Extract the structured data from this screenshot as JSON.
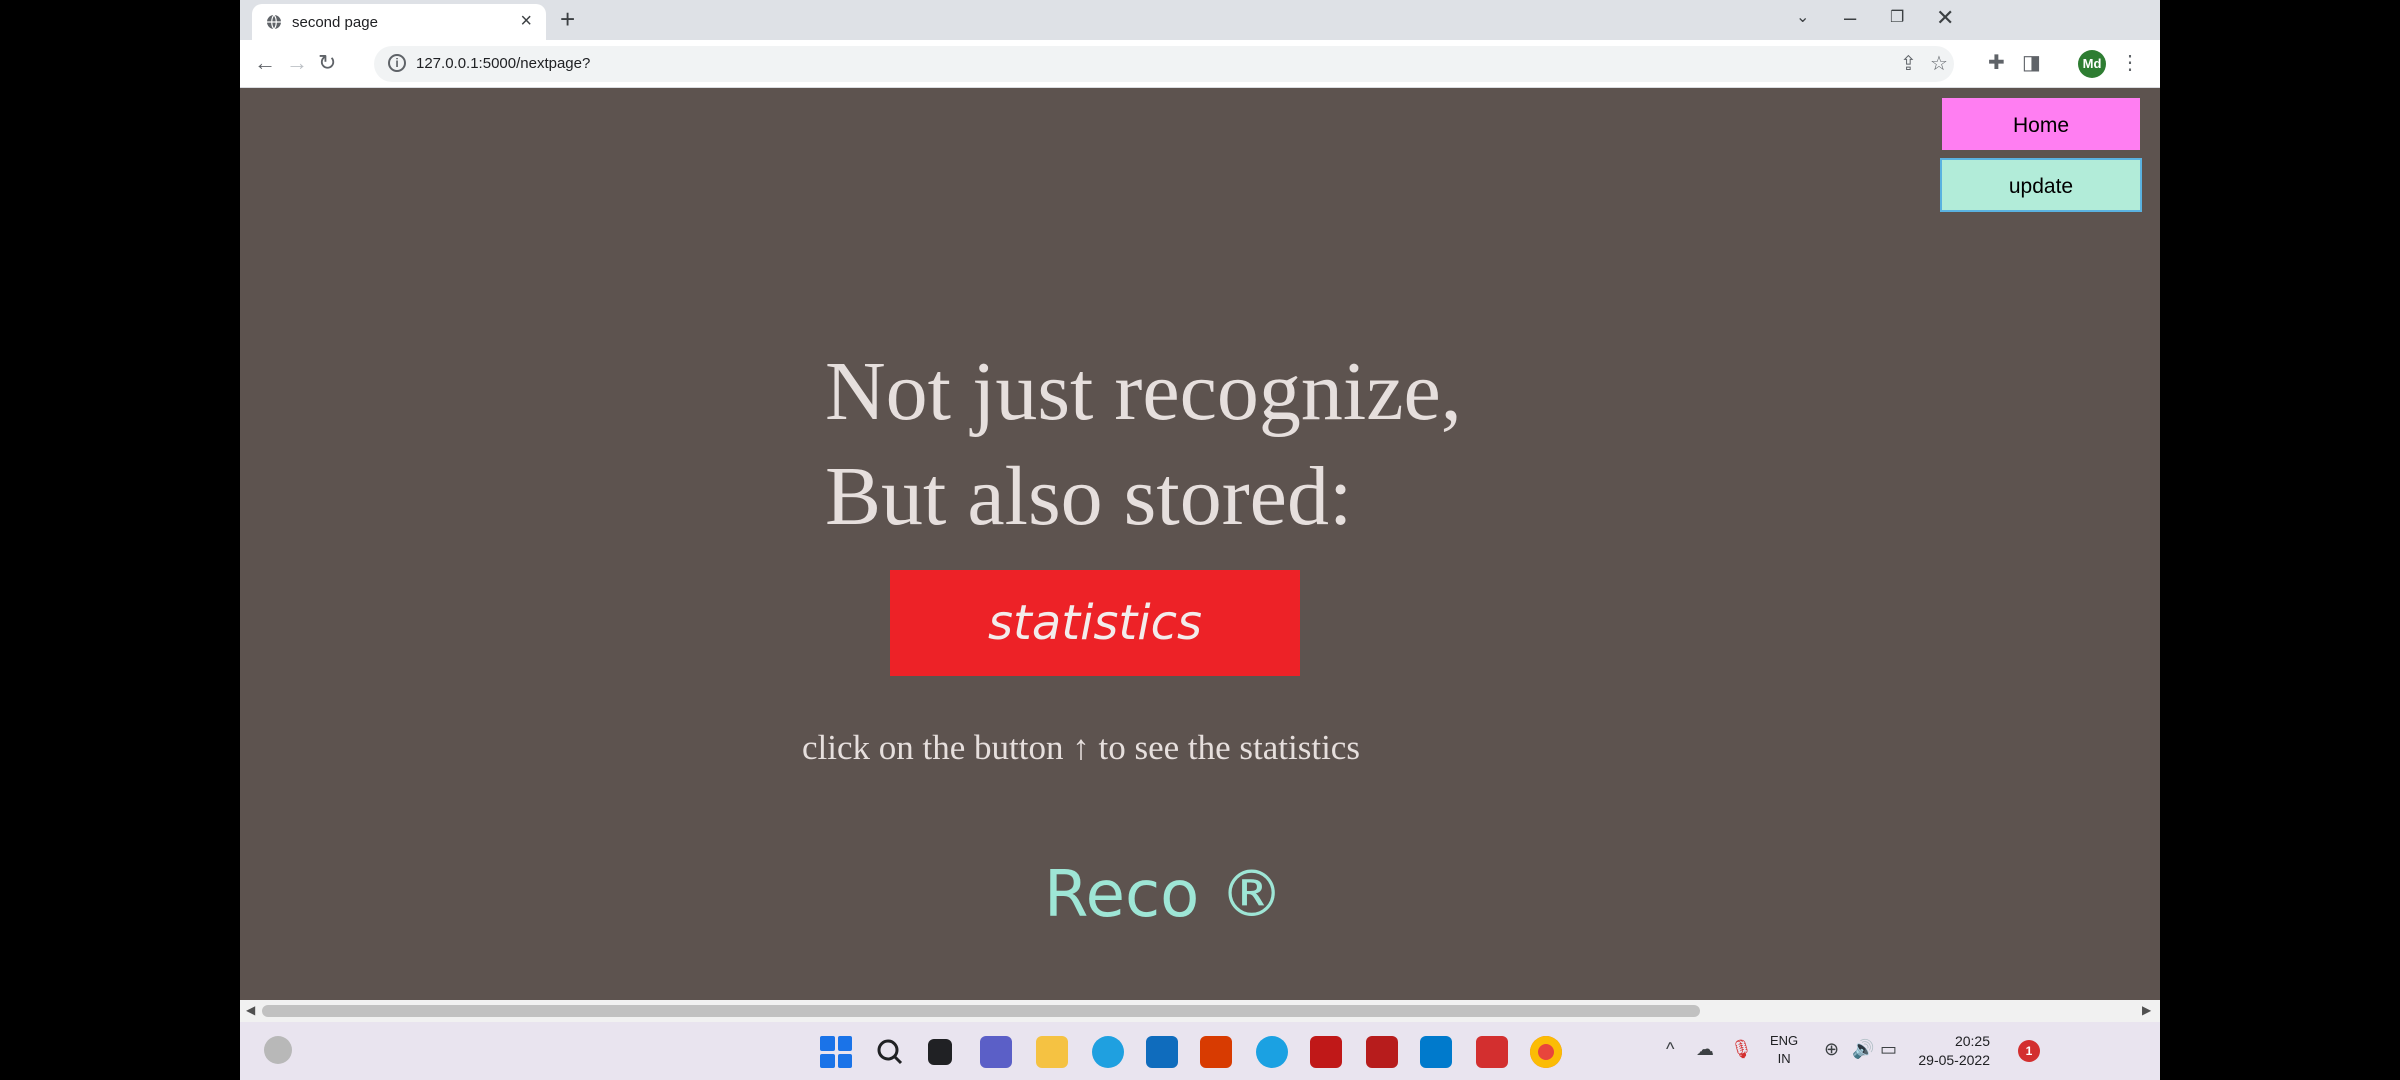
{
  "browser": {
    "tab_title": "second page",
    "url": "127.0.0.1:5000/nextpage?",
    "profile_initials": "Md"
  },
  "page": {
    "home_label": "Home",
    "update_label": "update",
    "headline_line1": "Not just recognize,",
    "headline_line2": "But also stored:",
    "stats_label": "statistics",
    "hint": "click on the button ↑ to see the statistics",
    "brand": "Reco ®"
  },
  "tray": {
    "lang_line1": "ENG",
    "lang_line2": "IN",
    "time": "20:25",
    "date": "29-05-2022",
    "notification_count": "1"
  },
  "colors": {
    "page_background": "#5d534f",
    "home_button": "#ff7ef2",
    "update_button": "#b2ecd9",
    "stats_button": "#ed2227",
    "brand_text": "#9ee6d6"
  },
  "icons": {
    "tab": "globe-icon",
    "toolbar": [
      "back-icon",
      "forward-icon",
      "reload-icon",
      "info-icon",
      "share-icon",
      "star-icon",
      "extensions-icon",
      "sidepanel-icon",
      "menu-icon"
    ],
    "taskbar": [
      "start-icon",
      "search-icon",
      "taskview-icon",
      "meet-icon",
      "explorer-icon",
      "edge-icon",
      "store-icon",
      "office-icon",
      "skype-icon",
      "mcafee-icon",
      "app-icon",
      "vscode-icon",
      "screen-recorder-icon",
      "chrome-icon"
    ]
  }
}
